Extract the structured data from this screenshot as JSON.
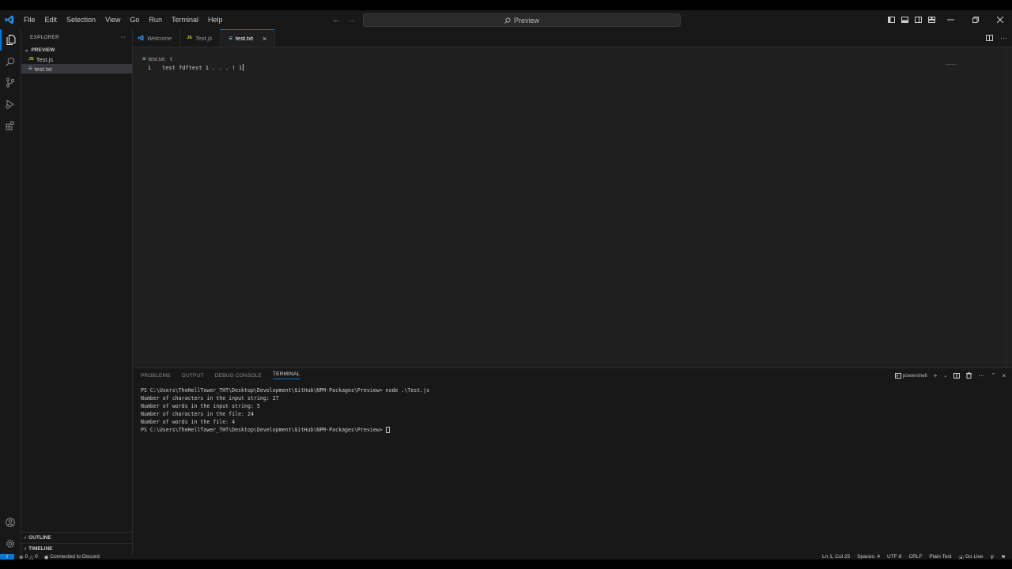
{
  "menu": [
    "File",
    "Edit",
    "Selection",
    "View",
    "Go",
    "Run",
    "Terminal",
    "Help"
  ],
  "command_center": {
    "label": "Preview"
  },
  "sidebar": {
    "title": "EXPLORER",
    "folder": "PREVIEW",
    "files": [
      {
        "name": "Test.js",
        "badge": "JS"
      },
      {
        "name": "test.txt",
        "badge": "≡"
      }
    ],
    "outline": "OUTLINE",
    "timeline": "TIMELINE"
  },
  "tabs": [
    {
      "label": "Welcome"
    },
    {
      "label": "Test.js",
      "badge": "JS"
    },
    {
      "label": "test.txt",
      "badge": "≡"
    }
  ],
  "breadcrumb": {
    "file": "test.txt"
  },
  "editor": {
    "line_number": "1",
    "content": "test fdftest 1 . . . ! 1"
  },
  "panel": {
    "tabs": [
      "PROBLEMS",
      "OUTPUT",
      "DEBUG CONSOLE",
      "TERMINAL"
    ],
    "shell": "powershell",
    "terminal_lines": [
      "PS C:\\Users\\TheHellTower_THT\\Desktop\\Development\\GitHub\\NPM-Packages\\Preview> node .\\Test.js",
      "Number of characters in the input string: 27",
      "Number of words in the input string: 5",
      "Number of characters in the file: 24",
      "Number of words in the file: 4"
    ],
    "prompt": "PS C:\\Users\\TheHellTower_THT\\Desktop\\Development\\GitHub\\NPM-Packages\\Preview> "
  },
  "status": {
    "errors": "0",
    "warnings": "0",
    "discord": "Connected to Discord",
    "position": "Ln 1, Col 25",
    "spaces": "Spaces: 4",
    "encoding": "UTF-8",
    "eol": "CRLF",
    "language": "Plain Text",
    "golive": "Go Live"
  },
  "colors": {
    "accent": "#0078d4",
    "background": "#1f1f1f",
    "chrome": "#181818",
    "js_badge": "#cbcb41"
  }
}
